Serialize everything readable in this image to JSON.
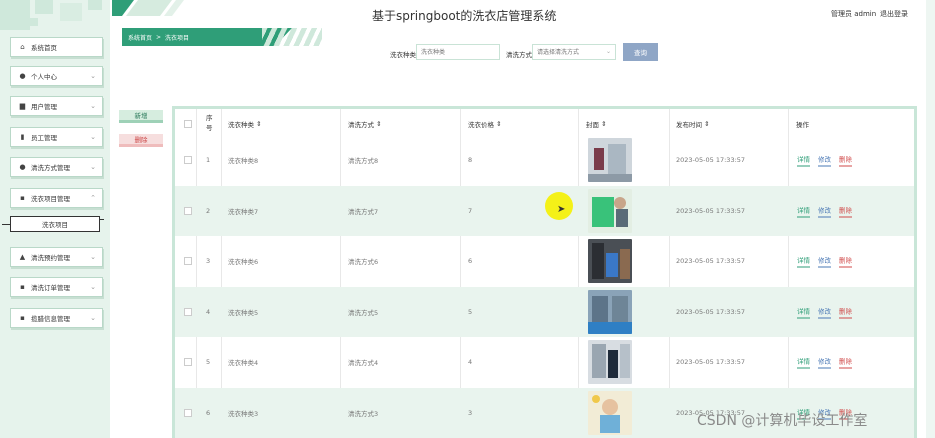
{
  "app": {
    "title": "基于springboot的洗衣店管理系统",
    "admin_label": "管理员 admin",
    "logout_label": "退出登录"
  },
  "sidebar": {
    "items": [
      {
        "label": "系统首页",
        "icon": "home-icon"
      },
      {
        "label": "个人中心",
        "icon": "user-icon"
      },
      {
        "label": "用户管理",
        "icon": "doc-icon"
      },
      {
        "label": "员工管理",
        "icon": "clipboard-icon"
      },
      {
        "label": "清洗方式管理",
        "icon": "user-icon"
      },
      {
        "label": "洗衣项目管理",
        "icon": "grid-icon"
      },
      {
        "label": "清洗预约管理",
        "icon": "thumb-icon"
      },
      {
        "label": "清洗订单管理",
        "icon": "grid-icon"
      },
      {
        "label": "揽腊信息管理",
        "icon": "grid-icon"
      }
    ],
    "submenu": {
      "label": "洗衣项目"
    }
  },
  "breadcrumb": {
    "home": "系统首页",
    "separator": ">",
    "current": "洗衣项目"
  },
  "search": {
    "type_label": "洗衣种类",
    "type_placeholder": "洗衣种类",
    "method_label": "清洗方式",
    "method_placeholder": "请选择清洗方式",
    "button_label": "查询"
  },
  "actions": {
    "add_label": "新增",
    "delete_label": "删除"
  },
  "table": {
    "headers": {
      "index": "序号",
      "type": "洗衣种类",
      "method": "清洗方式",
      "price": "洗衣价格",
      "cover": "封面",
      "time": "发布时间",
      "ops": "操作"
    },
    "rows": [
      {
        "index": "1",
        "type": "洗衣种类8",
        "method": "清洗方式8",
        "price": "8",
        "time": "2023-05-05 17:33:57"
      },
      {
        "index": "2",
        "type": "洗衣种类7",
        "method": "清洗方式7",
        "price": "7",
        "time": "2023-05-05 17:33:57"
      },
      {
        "index": "3",
        "type": "洗衣种类6",
        "method": "清洗方式6",
        "price": "6",
        "time": "2023-05-05 17:33:57"
      },
      {
        "index": "4",
        "type": "洗衣种类5",
        "method": "清洗方式5",
        "price": "5",
        "time": "2023-05-05 17:33:57"
      },
      {
        "index": "5",
        "type": "洗衣种类4",
        "method": "清洗方式4",
        "price": "4",
        "time": "2023-05-05 17:33:57"
      },
      {
        "index": "6",
        "type": "洗衣种类3",
        "method": "清洗方式3",
        "price": "3",
        "time": "2023-05-05 17:33:57"
      }
    ],
    "op_labels": {
      "detail": "详情",
      "edit": "修改",
      "delete": "删除"
    }
  },
  "watermark": "CSDN @计算机毕设工作室",
  "colors": {
    "accent": "#2f9e78",
    "sidebar_bg": "#e6f3ec",
    "row_alt": "#e9f4ee",
    "search_button": "#8fa6c6"
  }
}
